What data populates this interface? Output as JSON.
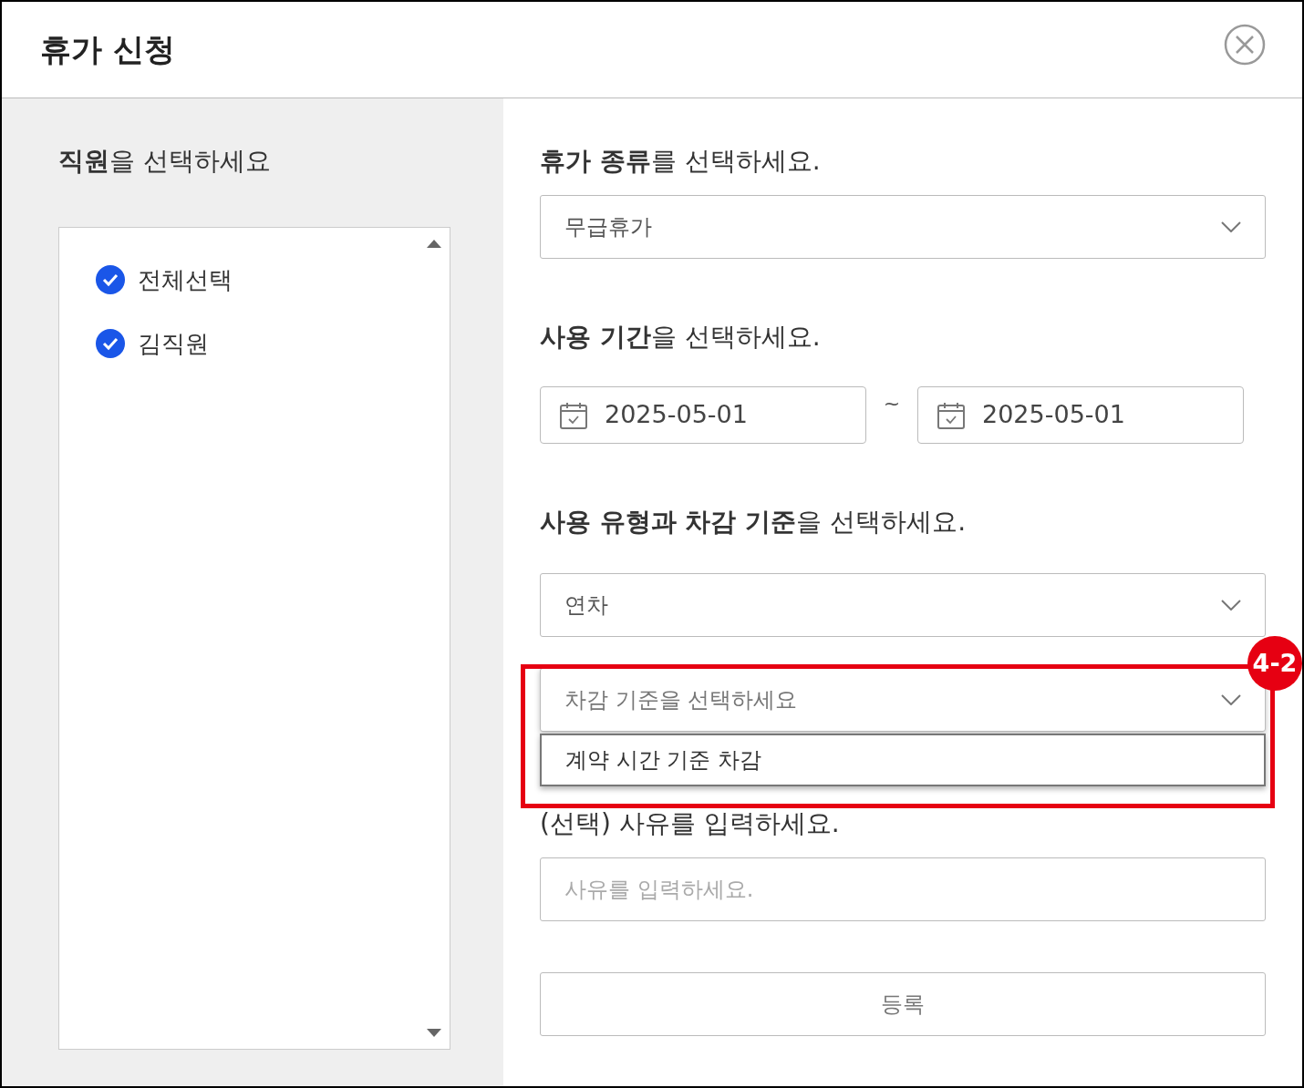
{
  "dialog": {
    "title": "휴가 신청"
  },
  "employees": {
    "heading": "**직원**을 선택하세요",
    "items": [
      {
        "label": "전체선택",
        "checked": true
      },
      {
        "label": "김직원",
        "checked": true
      }
    ]
  },
  "leave_type": {
    "heading": "**휴가 종류**를 선택하세요.",
    "value": "무급휴가"
  },
  "period": {
    "heading": "**사용 기간**을 선택하세요.",
    "start": "2025-05-01",
    "separator": "~",
    "end": "2025-05-01"
  },
  "usage": {
    "heading": "**사용 유형과 차감 기준**을 선택하세요.",
    "type_value": "연차",
    "criteria_placeholder": "차감 기준을 선택하세요",
    "criteria_expanded": true,
    "options": [
      {
        "label": "계약 시간 기준 차감",
        "selected": false
      }
    ]
  },
  "reason": {
    "heading": "(선택) 사유를 입력하세요.",
    "placeholder": "사유를 입력하세요."
  },
  "submit": "등록",
  "annotation": {
    "label": "4-2"
  }
}
